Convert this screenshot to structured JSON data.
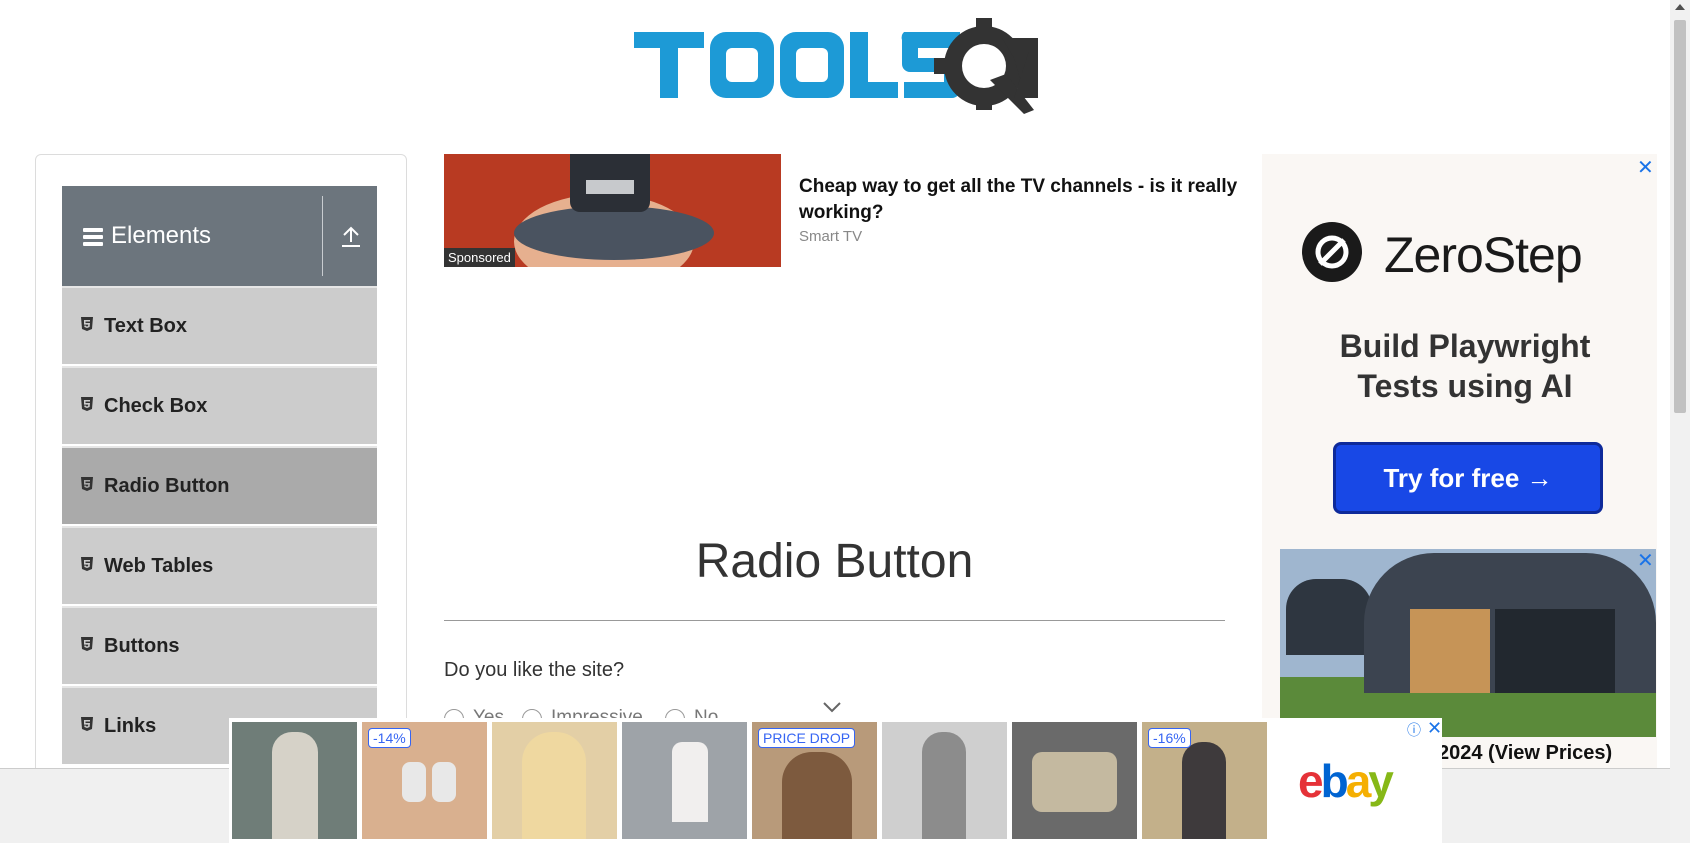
{
  "header": {
    "logo_alt": "TOOLSQA"
  },
  "sidebar": {
    "group_title": "Elements",
    "items": [
      {
        "label": "Text Box",
        "active": false
      },
      {
        "label": "Check Box",
        "active": false
      },
      {
        "label": "Radio Button",
        "active": true
      },
      {
        "label": "Web Tables",
        "active": false
      },
      {
        "label": "Buttons",
        "active": false
      },
      {
        "label": "Links",
        "active": false
      }
    ]
  },
  "top_ad": {
    "tag": "Sponsored",
    "headline": "Cheap way to get all the TV channels - is it really working?",
    "source": "Smart TV"
  },
  "main": {
    "title": "Radio Button",
    "question": "Do you like the site?",
    "options": [
      "Yes",
      "Impressive",
      "No"
    ]
  },
  "right_ad": {
    "close": "✕",
    "brand": "ZeroStep",
    "tagline": "Build Playwright Tests using AI",
    "cta": "Try for free →",
    "second_close": "✕",
    "second_text": "2024 (View Prices)"
  },
  "bottom_ad": {
    "badges": [
      "-14%",
      "PRICE DROP",
      "-16%"
    ],
    "logo": [
      "e",
      "b",
      "a",
      "y"
    ],
    "info_icon": "ⓘ",
    "close": "✕"
  },
  "colors": {
    "brand_blue": "#1d9ad6",
    "brand_dark": "#333333",
    "sidebar_header": "#6c757d",
    "sidebar_item": "#cccccc",
    "sidebar_active": "#aaaaaa",
    "cta_blue": "#1848e6"
  }
}
